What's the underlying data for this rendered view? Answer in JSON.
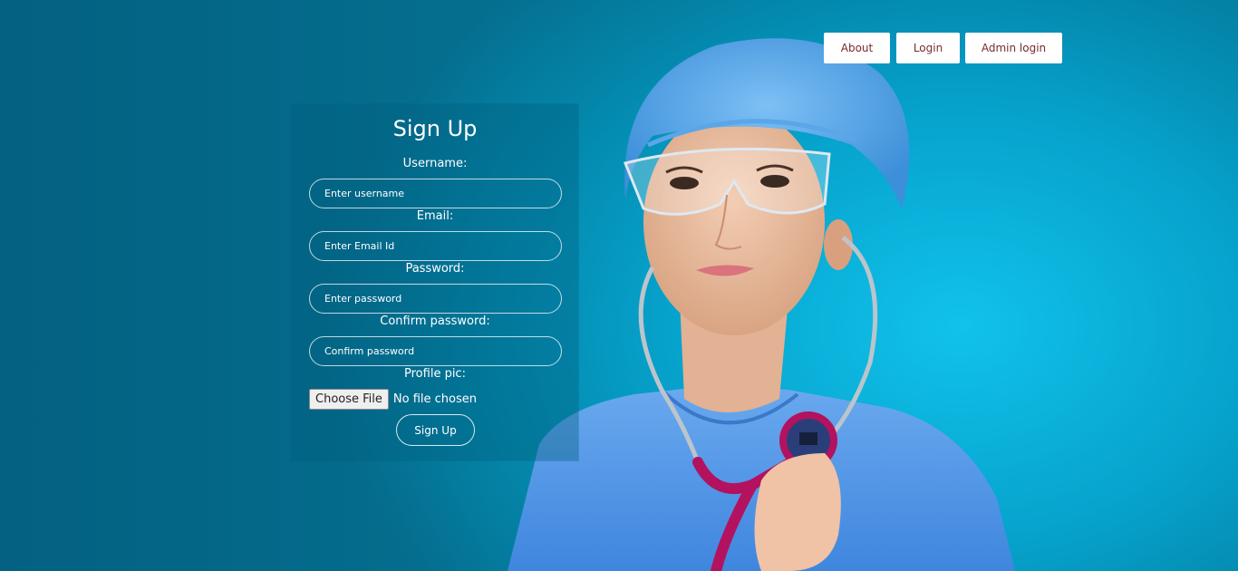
{
  "nav": {
    "about": "About",
    "login": "Login",
    "admin_login": "Admin login"
  },
  "form": {
    "title": "Sign Up",
    "username": {
      "label": "Username:",
      "placeholder": "Enter username"
    },
    "email": {
      "label": "Email:",
      "placeholder": "Enter Email Id"
    },
    "password": {
      "label": "Password:",
      "placeholder": "Enter password"
    },
    "confirm_password": {
      "label": "Confirm password:",
      "placeholder": "Confirm password"
    },
    "profile_pic": {
      "label": "Profile pic:",
      "button": "Choose File",
      "status": "No file chosen"
    },
    "submit": "Sign Up"
  },
  "colors": {
    "background": "#06a3cd",
    "nav_text": "#7a2b2b",
    "scrubs": "#4f95e6",
    "stethoscope": "#b3125f"
  }
}
